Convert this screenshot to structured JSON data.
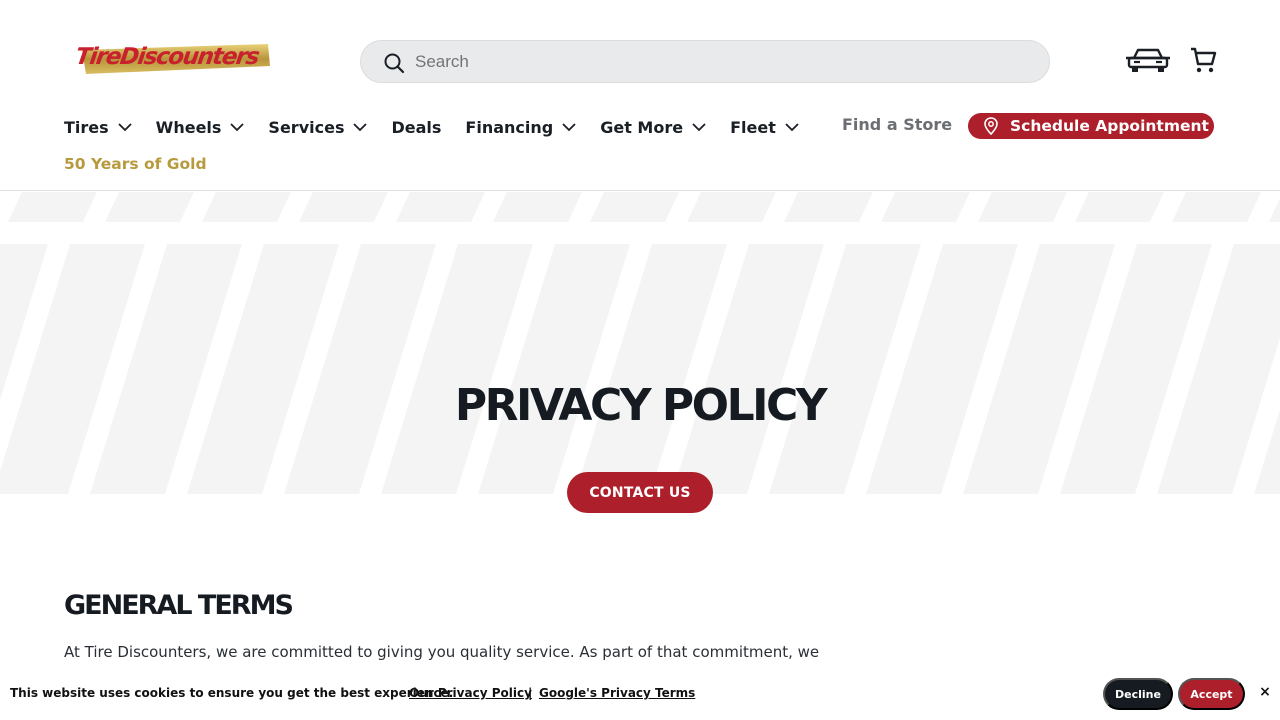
{
  "header": {
    "logo_text": "TireDiscounters",
    "search": {
      "placeholder": "Search"
    },
    "nav": [
      {
        "label": "Tires"
      },
      {
        "label": "Wheels"
      },
      {
        "label": "Services"
      },
      {
        "label": "Deals"
      },
      {
        "label": "Financing"
      },
      {
        "label": "Get More"
      },
      {
        "label": "Fleet"
      }
    ],
    "find_store": "Find a Store",
    "schedule_label": "Schedule Appointment",
    "gold_link": "50 Years of Gold"
  },
  "hero": {
    "title": "PRIVACY POLICY",
    "contact_label": "CONTACT US"
  },
  "content": {
    "section_title": "GENERAL TERMS",
    "section_body": "At Tire Discounters, we are committed to giving you quality service. As part of that commitment, we"
  },
  "cookie_bar": {
    "message": "This website uses cookies to ensure you get the best experience.",
    "privacy_link": "Our Privacy Policy",
    "separator": "|",
    "google_link": "Google's Privacy Terms",
    "decline_label": "Decline",
    "accept_label": "Accept",
    "close_label": "×"
  },
  "colors": {
    "brand_red": "#ad1f2a",
    "gold": "#b89a3e",
    "dark": "#161b22"
  }
}
